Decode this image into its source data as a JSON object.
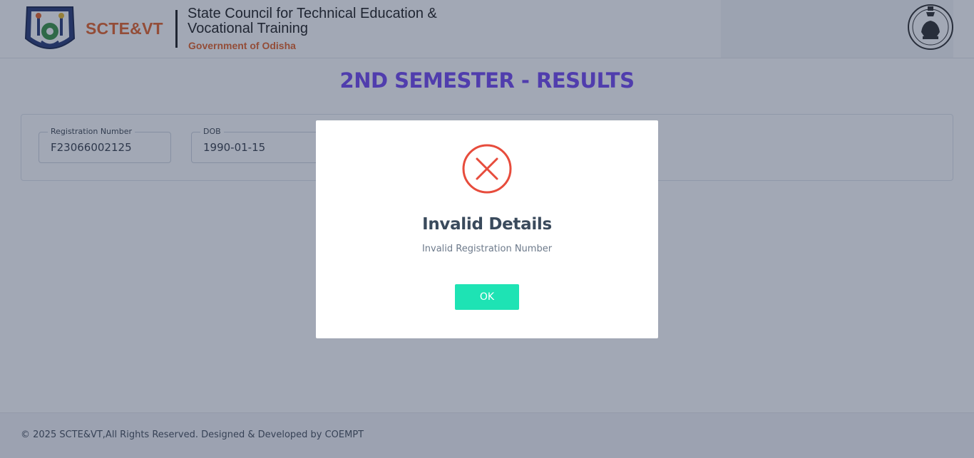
{
  "header": {
    "brand_short": "SCTE&VT",
    "brand_full": "State Council for Technical Education & Vocational Training",
    "brand_sub": "Government of Odisha",
    "seal_icon": "scte-seal-logo",
    "emblem_icon": "odisha-emblem"
  },
  "page_title": "2ND SEMESTER - RESULTS",
  "form": {
    "registration": {
      "label": "Registration Number",
      "value": "F23066002125"
    },
    "dob": {
      "label": "DOB",
      "value": "1990-01-15"
    }
  },
  "modal": {
    "icon": "error-x-icon",
    "title": "Invalid Details",
    "message": "Invalid Registration Number",
    "ok_label": "OK"
  },
  "footer": {
    "text": "© 2025 SCTE&VT,All Rights Reserved. Designed & Developed by COEMPT"
  },
  "colors": {
    "accent": "#6a3df0",
    "brand_orange": "#e35a1c",
    "error_red": "#e74c3c",
    "ok_green": "#1ee3b4"
  }
}
